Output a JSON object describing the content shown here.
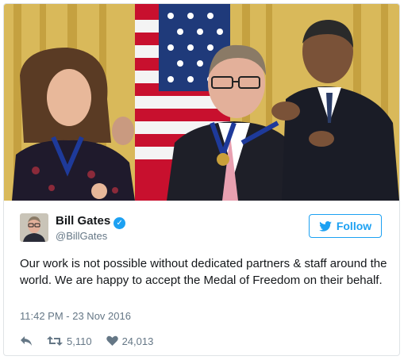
{
  "tweet": {
    "name": "Bill Gates",
    "verified_icon": "verified-badge-icon",
    "handle": "@BillGates",
    "follow_label": "Follow",
    "text": "Our work is not possible without dedicated partners & staff around the world. We are happy to accept the Medal of Freedom on their behalf.",
    "timestamp": "11:42 PM - 23 Nov 2016",
    "retweets": "5,110",
    "likes": "24,013"
  },
  "icons": {
    "reply": "reply-icon",
    "retweet": "retweet-icon",
    "like": "heart-icon",
    "follow_bird": "twitter-bird-icon"
  },
  "colors": {
    "accent": "#1da1f2",
    "text": "#14171a",
    "muted": "#657786",
    "border": "#dfe3e6"
  }
}
